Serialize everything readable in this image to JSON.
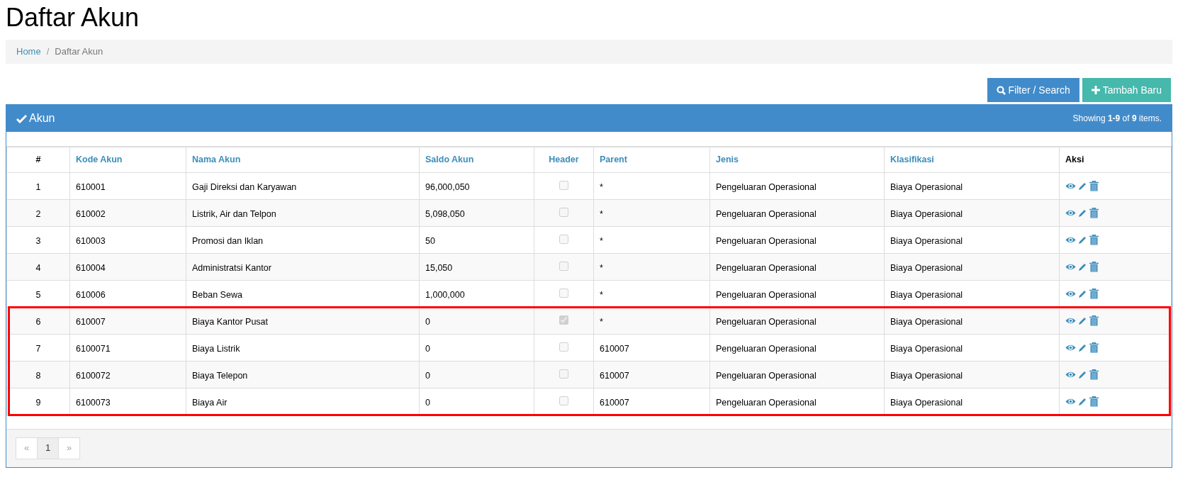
{
  "page_title": "Daftar Akun",
  "breadcrumb_separator": "/",
  "breadcrumb": [
    {
      "label": "Home",
      "selected": false
    },
    {
      "label": "Daftar Akun",
      "selected": true
    }
  ],
  "toolbar": [
    {
      "label": "Filter / Search",
      "kind": "search"
    },
    {
      "label": "Tambah Baru",
      "kind": "add"
    }
  ],
  "panel": {
    "title": "Akun",
    "summary": "Showing **1-9** of **9** items."
  },
  "table": {
    "columns": [
      {
        "label": "#",
        "sortable": false
      },
      {
        "label": "Kode Akun",
        "sortable": true
      },
      {
        "label": "Nama Akun",
        "sortable": true
      },
      {
        "label": "Saldo Akun",
        "sortable": true
      },
      {
        "label": "Header",
        "sortable": true
      },
      {
        "label": "Parent",
        "sortable": true
      },
      {
        "label": "Jenis",
        "sortable": true
      },
      {
        "label": "Klasifikasi",
        "sortable": true
      },
      {
        "label": "Aksi",
        "sortable": false
      }
    ],
    "rows": [
      {
        "no": "1",
        "kode": "610001",
        "nama": "Gaji Direksi dan Karyawan",
        "saldo": "96,000,050",
        "header": false,
        "parent": "*",
        "jenis": "Pengeluaran Operasional",
        "klasifikasi": "Biaya Operasional",
        "highlighted": false
      },
      {
        "no": "2",
        "kode": "610002",
        "nama": "Listrik, Air dan Telpon",
        "saldo": "5,098,050",
        "header": false,
        "parent": "*",
        "jenis": "Pengeluaran Operasional",
        "klasifikasi": "Biaya Operasional",
        "highlighted": false
      },
      {
        "no": "3",
        "kode": "610003",
        "nama": "Promosi dan Iklan",
        "saldo": "50",
        "header": false,
        "parent": "*",
        "jenis": "Pengeluaran Operasional",
        "klasifikasi": "Biaya Operasional",
        "highlighted": false
      },
      {
        "no": "4",
        "kode": "610004",
        "nama": "Administratsi Kantor",
        "saldo": "15,050",
        "header": false,
        "parent": "*",
        "jenis": "Pengeluaran Operasional",
        "klasifikasi": "Biaya Operasional",
        "highlighted": false
      },
      {
        "no": "5",
        "kode": "610006",
        "nama": "Beban Sewa",
        "saldo": "1,000,000",
        "header": false,
        "parent": "*",
        "jenis": "Pengeluaran Operasional",
        "klasifikasi": "Biaya Operasional",
        "highlighted": false
      },
      {
        "no": "6",
        "kode": "610007",
        "nama": "Biaya Kantor Pusat",
        "saldo": "0",
        "header": true,
        "parent": "*",
        "jenis": "Pengeluaran Operasional",
        "klasifikasi": "Biaya Operasional",
        "highlighted": true
      },
      {
        "no": "7",
        "kode": "6100071",
        "nama": "Biaya Listrik",
        "saldo": "0",
        "header": false,
        "parent": "610007",
        "jenis": "Pengeluaran Operasional",
        "klasifikasi": "Biaya Operasional",
        "highlighted": true
      },
      {
        "no": "8",
        "kode": "6100072",
        "nama": "Biaya Telepon",
        "saldo": "0",
        "header": false,
        "parent": "610007",
        "jenis": "Pengeluaran Operasional",
        "klasifikasi": "Biaya Operasional",
        "highlighted": true
      },
      {
        "no": "9",
        "kode": "6100073",
        "nama": "Biaya Air",
        "saldo": "0",
        "header": false,
        "parent": "610007",
        "jenis": "Pengeluaran Operasional",
        "klasifikasi": "Biaya Operasional",
        "highlighted": true
      }
    ]
  },
  "pagination": [
    {
      "label": "«",
      "disabled": true,
      "selected": false
    },
    {
      "label": "1",
      "disabled": false,
      "selected": true
    },
    {
      "label": "»",
      "disabled": true,
      "selected": false
    }
  ]
}
